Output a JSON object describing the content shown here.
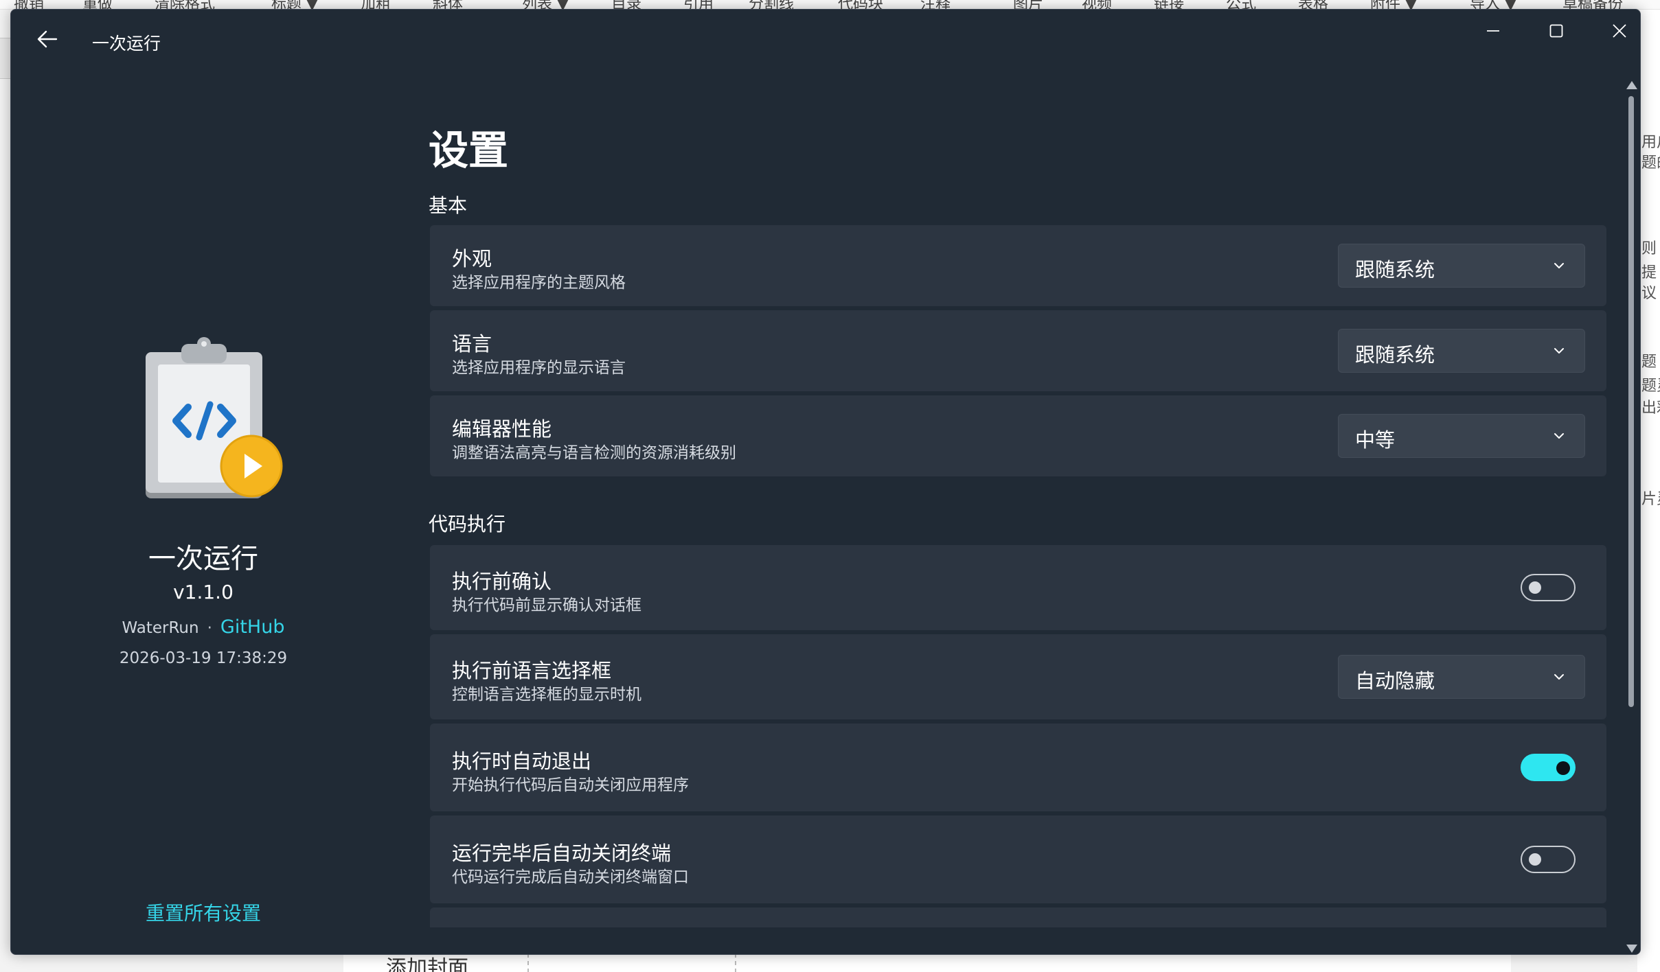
{
  "background": {
    "toolbar_items": [
      "撤销",
      "重做",
      "清除格式",
      "标题 ▼",
      "加粗",
      "斜体",
      "列表 ▼",
      "目录",
      "引用",
      "分割线",
      "代码块",
      "注释",
      "图片",
      "视频",
      "链接",
      "公式",
      "表格",
      "附件 ▼",
      "导入 ▼",
      "草稿备份"
    ],
    "right_texts": [
      "用户",
      "题的",
      "则",
      "提",
      "议",
      "题",
      "题灵",
      "出彩",
      "片灵"
    ],
    "bottom_text": "添加封面"
  },
  "window": {
    "title": "一次运行",
    "back_icon": "arrow-left-icon",
    "minimize_icon": "minimize-icon",
    "maximize_icon": "maximize-icon",
    "close_icon": "close-icon"
  },
  "about": {
    "icon": "clipboard-code-play-icon",
    "name": "一次运行",
    "version": "v1.1.0",
    "author": "WaterRun",
    "separator": "·",
    "github_label": "GitHub",
    "build_date": "2026-03-19 17:38:29",
    "reset_label": "重置所有设置"
  },
  "settings": {
    "page_title": "设置",
    "section_basic": "基本",
    "section_exec": "代码执行",
    "items": [
      {
        "title": "外观",
        "desc": "选择应用程序的主题风格",
        "control": "dropdown",
        "value": "跟随系统"
      },
      {
        "title": "语言",
        "desc": "选择应用程序的显示语言",
        "control": "dropdown",
        "value": "跟随系统"
      },
      {
        "title": "编辑器性能",
        "desc": "调整语法高亮与语言检测的资源消耗级别",
        "control": "dropdown",
        "value": "中等"
      },
      {
        "title": "执行前确认",
        "desc": "执行代码前显示确认对话框",
        "control": "toggle",
        "value": "off"
      },
      {
        "title": "执行前语言选择框",
        "desc": "控制语言选择框的显示时机",
        "control": "dropdown",
        "value": "自动隐藏"
      },
      {
        "title": "执行时自动退出",
        "desc": "开始执行代码后自动关闭应用程序",
        "control": "toggle",
        "value": "on"
      },
      {
        "title": "运行完毕后自动关闭终端",
        "desc": "代码运行完成后自动关闭终端窗口",
        "control": "toggle",
        "value": "off"
      }
    ]
  },
  "colors": {
    "window_bg": "#202a35",
    "card_bg": "#2c3541",
    "accent": "#2ee6f0",
    "link": "#35d5e8"
  }
}
